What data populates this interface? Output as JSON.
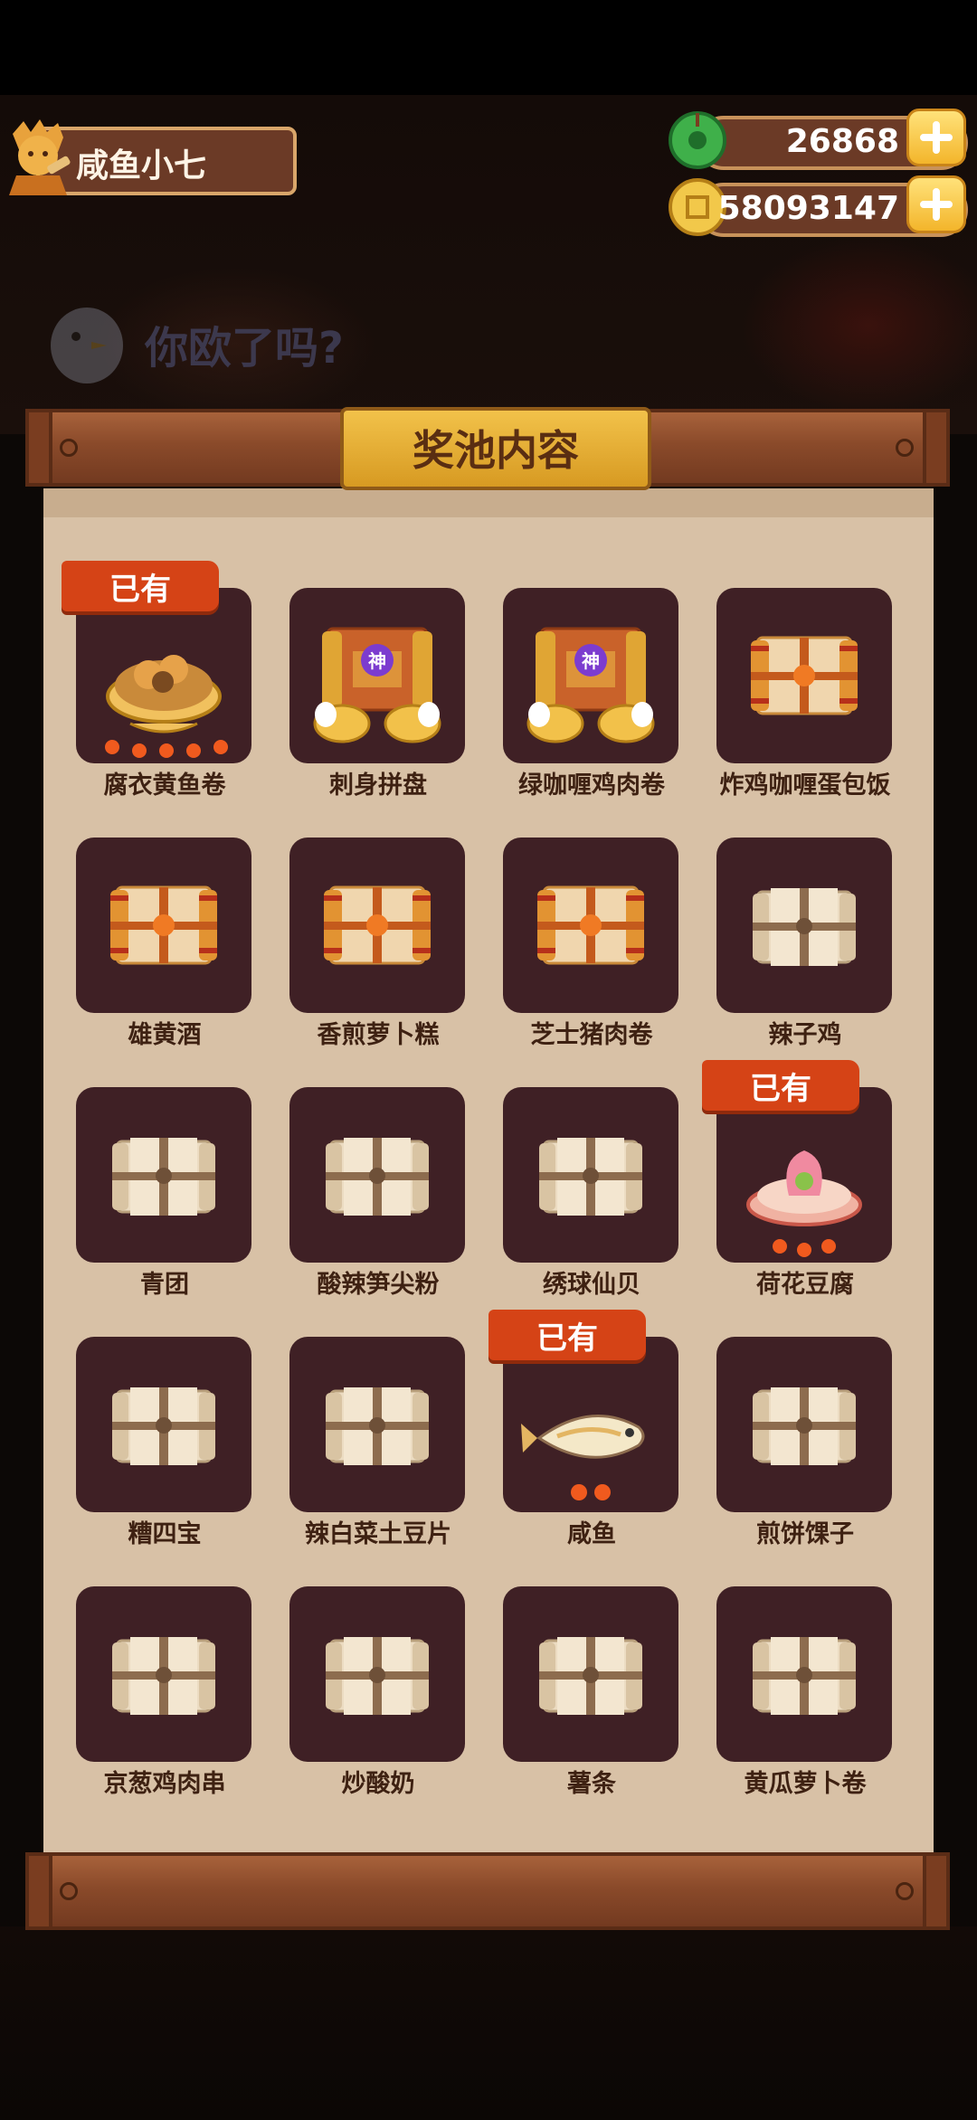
{
  "player": {
    "name": "咸鱼小七"
  },
  "currencies": {
    "jade": {
      "value": "26868",
      "icon": "jade-icon"
    },
    "coins": {
      "value": "58093147",
      "icon": "coin-icon"
    }
  },
  "banner_text": "你欧了吗?",
  "panel": {
    "title": "奖池内容"
  },
  "owned_label": "已有",
  "items": [
    {
      "name": "腐衣黄鱼卷",
      "owned": true,
      "icon": "dish-icon"
    },
    {
      "name": "刺身拼盘",
      "owned": false,
      "icon": "god-pack-icon"
    },
    {
      "name": "绿咖喱鸡肉卷",
      "owned": false,
      "icon": "god-pack-icon"
    },
    {
      "name": "炸鸡咖喱蛋包饭",
      "owned": false,
      "icon": "gold-scroll-icon"
    },
    {
      "name": "雄黄酒",
      "owned": false,
      "icon": "gold-scroll-icon"
    },
    {
      "name": "香煎萝卜糕",
      "owned": false,
      "icon": "gold-scroll-icon"
    },
    {
      "name": "芝士猪肉卷",
      "owned": false,
      "icon": "gold-scroll-icon"
    },
    {
      "name": "辣子鸡",
      "owned": false,
      "icon": "scroll-icon"
    },
    {
      "name": "青团",
      "owned": false,
      "icon": "scroll-icon"
    },
    {
      "name": "酸辣笋尖粉",
      "owned": false,
      "icon": "scroll-icon"
    },
    {
      "name": "绣球仙贝",
      "owned": false,
      "icon": "scroll-icon"
    },
    {
      "name": "荷花豆腐",
      "owned": true,
      "icon": "lotus-tofu-icon"
    },
    {
      "name": "糟四宝",
      "owned": false,
      "icon": "scroll-icon"
    },
    {
      "name": "辣白菜土豆片",
      "owned": false,
      "icon": "scroll-icon"
    },
    {
      "name": "咸鱼",
      "owned": true,
      "icon": "fish-icon"
    },
    {
      "name": "煎饼馃子",
      "owned": false,
      "icon": "scroll-icon"
    },
    {
      "name": "京葱鸡肉串",
      "owned": false,
      "icon": "scroll-icon"
    },
    {
      "name": "炒酸奶",
      "owned": false,
      "icon": "scroll-icon"
    },
    {
      "name": "薯条",
      "owned": false,
      "icon": "scroll-icon"
    },
    {
      "name": "黄瓜萝卜卷",
      "owned": false,
      "icon": "scroll-icon"
    }
  ]
}
